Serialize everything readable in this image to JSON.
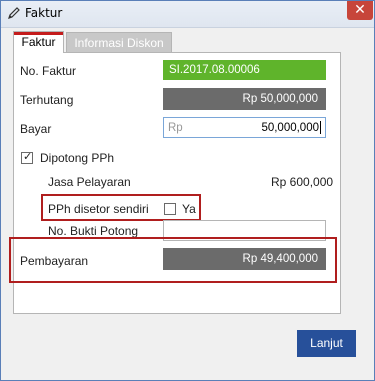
{
  "window": {
    "title": "Faktur",
    "close_glyph": "✕"
  },
  "tabs": [
    {
      "label": "Faktur",
      "active": true
    },
    {
      "label": "Informasi Diskon",
      "active": false
    }
  ],
  "form": {
    "no_faktur": {
      "label": "No. Faktur",
      "value": "SI.2017.08.00006"
    },
    "terhutang": {
      "label": "Terhutang",
      "value": "Rp 50,000,000"
    },
    "bayar": {
      "label": "Bayar",
      "placeholder": "Rp",
      "value": "50,000,000"
    },
    "dipotong_pph": {
      "label": "Dipotong PPh",
      "checked": true
    },
    "jasa_pelayaran": {
      "label": "Jasa Pelayaran",
      "value": "Rp 600,000"
    },
    "pph_disetor": {
      "label": "PPh disetor sendiri",
      "checkbox_label": "Ya",
      "checked": false
    },
    "no_bukti_potong": {
      "label": "No. Bukti Potong",
      "value": ""
    },
    "pembayaran": {
      "label": "Pembayaran",
      "value": "Rp 49,400,000"
    }
  },
  "footer": {
    "next_label": "Lanjut"
  },
  "colors": {
    "accent_red": "#b01e1e",
    "primary_blue": "#27509a",
    "green": "#5fb42b",
    "dark_field": "#6b6b6b"
  }
}
